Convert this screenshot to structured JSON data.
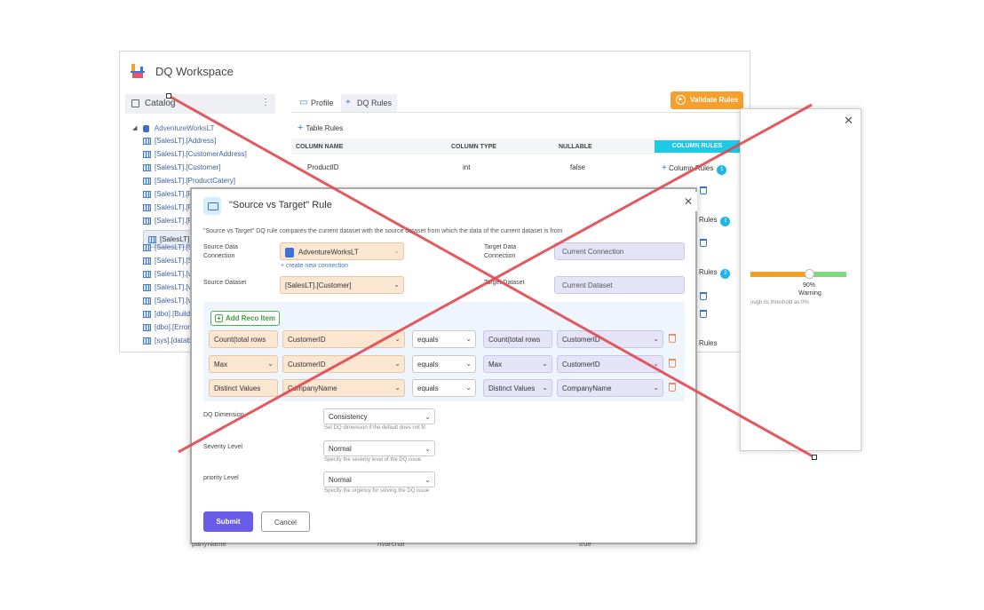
{
  "workspace": {
    "title": "DQ Workspace",
    "catalog_label": "Catalog",
    "kebab": "⋮",
    "tree": {
      "root": "AdventureWorksLT",
      "items": [
        "[SalesLT].[Address]",
        "[SalesLT].[CustomerAddress]",
        "[SalesLT].[Customer]",
        "[SalesLT].[ProductCatery]",
        "[SalesLT].[Pr",
        "[SalesLT].[Pr",
        "[SalesLT].[Pr",
        "[SalesLT].[Pr",
        "[SalesLT].[Sa",
        "[SalesLT].[Sa",
        "[SalesLT].[vG",
        "[SalesLT].[vP",
        "[SalesLT].[vP",
        "[dbo].[Build",
        "[dbo].[Error",
        "[sys].[datab"
      ]
    },
    "tabs": [
      "Profile",
      "DQ Rules"
    ],
    "validate_label": "Validate Rules",
    "table_rules": "Table Rules",
    "columns": [
      "COLUMN NAME",
      "COLUMN TYPE",
      "NULLABLE",
      "COLUMN RULES"
    ],
    "row": {
      "name": "ProductID",
      "type": "int",
      "nullable": "false",
      "rules_label": "Column Rules",
      "rules_count": "1"
    }
  },
  "right_dialog": {
    "close": "✕",
    "rules_peek": [
      "Rules",
      "Rules",
      "Rules"
    ],
    "counts": [
      "1",
      "2"
    ],
    "progress": {
      "value": 0.9,
      "pct_label": "90%",
      "status": "Warning",
      "threshold_text": "ough its threshold as 0%"
    },
    "colors": {
      "warn": "#f5a02c",
      "ok": "#7fd87f"
    }
  },
  "modal": {
    "title": "\"Source vs Target\" Rule",
    "close": "✕",
    "description": "\"Source vs Target\" DQ rule compares the current dataset with the source dataset from which the data of the current dataset is from",
    "source_conn_label": "Source Data Connection",
    "source_conn_value": "AdventureWorksLT",
    "new_connection": "+ create new connection",
    "target_conn_label": "Target Data Connection",
    "target_conn_value": "Current Connection",
    "source_dataset_label": "Source Dataset",
    "source_dataset_value": "[SalesLT].[Customer]",
    "target_dataset_label": "Target Dataset",
    "target_dataset_value": "Current Dataset",
    "add_reco": "Add Reco Item",
    "reco_rows": [
      {
        "src_agg": "Count(total rows",
        "src_col": "CustomerID",
        "op": "equals",
        "tgt_agg": "Count(total rows",
        "tgt_col": "CustomerID"
      },
      {
        "src_agg": "Max",
        "src_col": "CustomerID",
        "op": "equals",
        "tgt_agg": "Max",
        "tgt_col": "CustomerID"
      },
      {
        "src_agg": "Distinct Values",
        "src_col": "CompanyName",
        "op": "equals",
        "tgt_agg": "Distinct Values",
        "tgt_col": "CompanyName"
      }
    ],
    "dq_dimension_label": "DQ Dimension",
    "dq_dimension_value": "Consistency",
    "dq_dimension_hint": "Set DQ dimension if the default does not fit",
    "severity_label": "Severity Level",
    "severity_value": "Normal",
    "severity_hint": "Specify the severity level of the DQ issue",
    "priority_label": "priority Level",
    "priority_value": "Normal",
    "priority_hint": "Specify the urgency for solving the DQ issue",
    "submit": "Submit",
    "cancel": "Cancel"
  },
  "bleed_text": [
    "panyName",
    "nvarchar",
    "true"
  ],
  "overlay_color": "#e0474f"
}
